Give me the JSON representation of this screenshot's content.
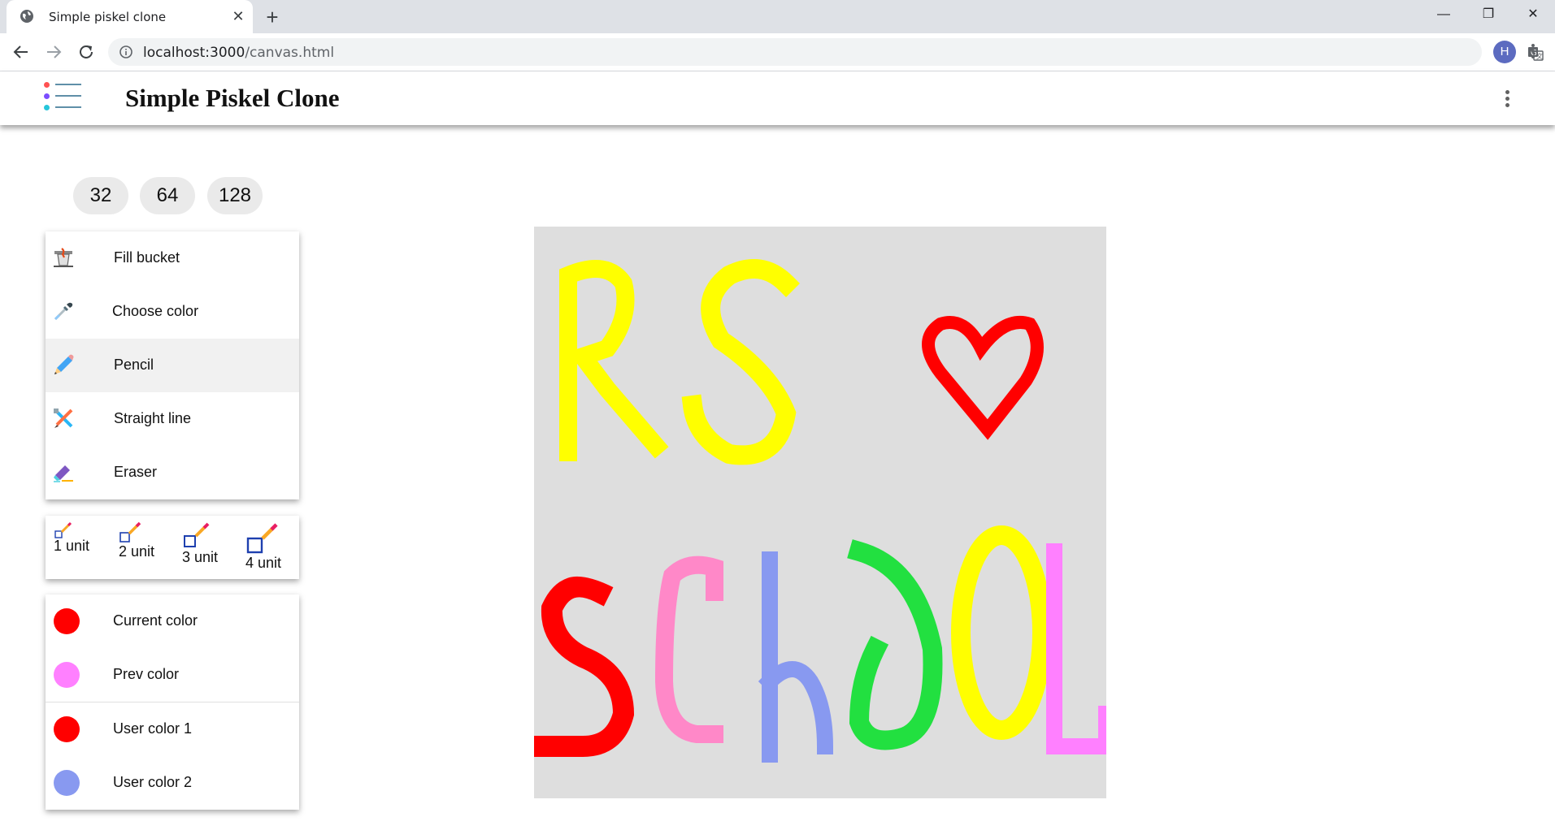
{
  "browser": {
    "tab_title": "Simple piskel clone",
    "url_host": "localhost:3000",
    "url_path": "/canvas.html",
    "avatar_letter": "H"
  },
  "app": {
    "title": "Simple Piskel Clone"
  },
  "sizes": [
    "32",
    "64",
    "128"
  ],
  "tools": [
    {
      "label": "Fill bucket",
      "icon": "fill-bucket-icon"
    },
    {
      "label": "Choose color",
      "icon": "eyedropper-icon"
    },
    {
      "label": "Pencil",
      "icon": "pencil-icon",
      "active": true
    },
    {
      "label": "Straight line",
      "icon": "straight-line-icon"
    },
    {
      "label": "Eraser",
      "icon": "eraser-icon"
    }
  ],
  "pen_units": [
    "1 unit",
    "2 unit",
    "3 unit",
    "4 unit"
  ],
  "colors": [
    {
      "label": "Current color",
      "color": "#ff0000"
    },
    {
      "label": "Prev color",
      "color": "#ff80ff"
    },
    {
      "label": "User color 1",
      "color": "#ff0000"
    },
    {
      "label": "User color 2",
      "color": "#8899f0"
    }
  ],
  "canvas": {
    "background": "#dedede",
    "drawing_text": [
      "RS",
      "SCHOOL"
    ],
    "stroke_colors": [
      "#ffff00",
      "#ff0000",
      "#ff88c8",
      "#8899f0",
      "#22e040",
      "#ff80ff"
    ]
  }
}
